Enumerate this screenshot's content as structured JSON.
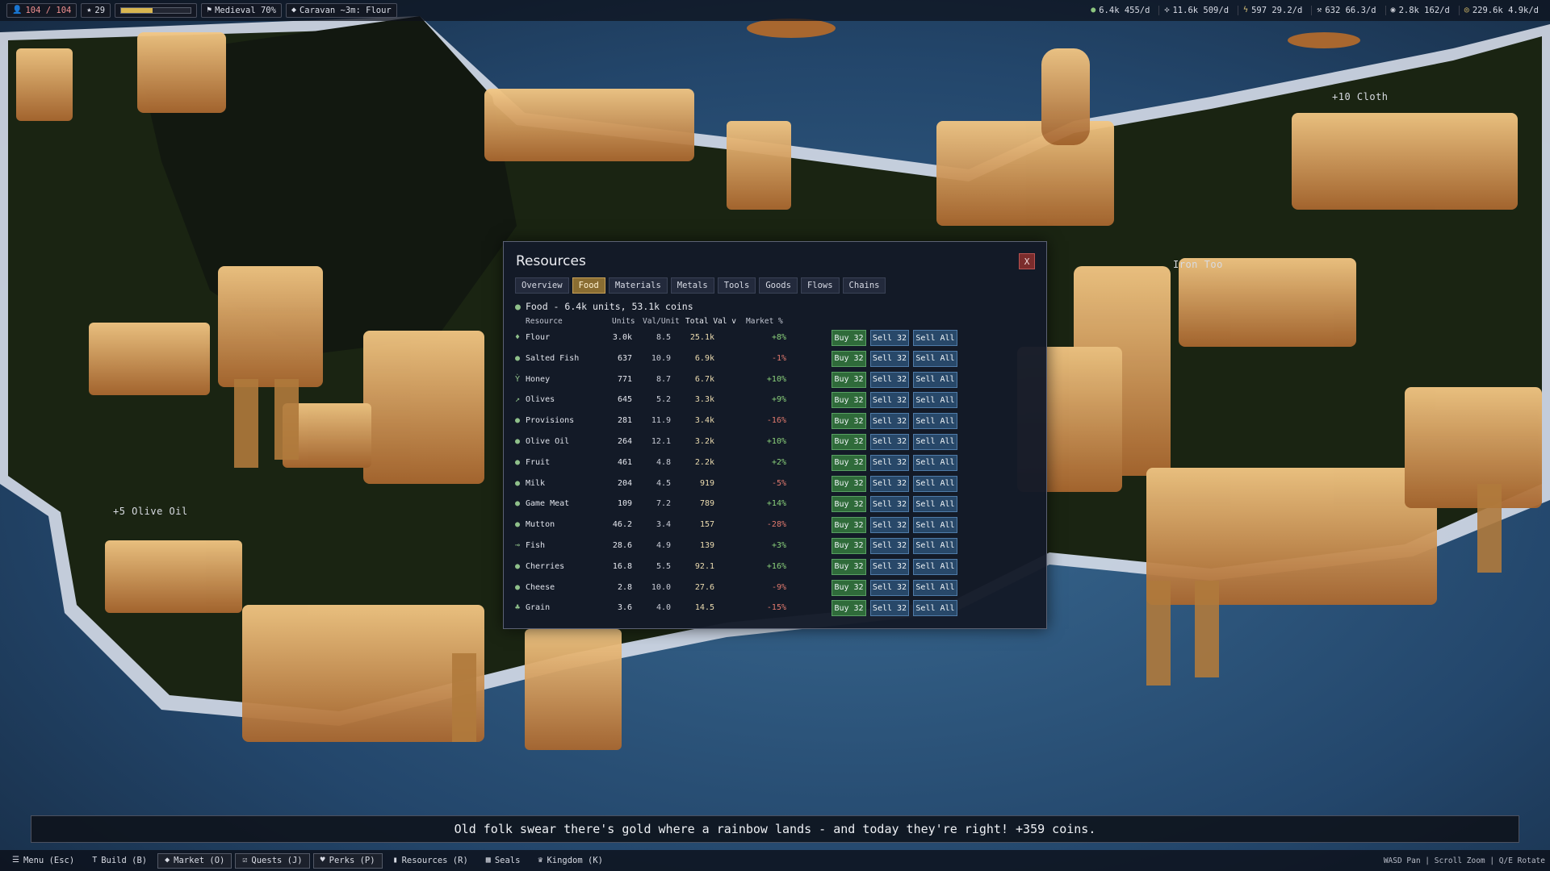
{
  "topbar": {
    "population": "104 / 104",
    "stars": "29",
    "progress_fraction": 0.45,
    "era": "Medieval 70%",
    "caravan": "Caravan ~3m: Flour",
    "resources": [
      {
        "icon": "food-icon",
        "glyph": "●",
        "text": "6.4k 455/d",
        "color": "#8cc47e"
      },
      {
        "icon": "materials-icon",
        "glyph": "✣",
        "text": "11.6k 509/d",
        "color": "#c8cbd4"
      },
      {
        "icon": "energy-icon",
        "glyph": "ϟ",
        "text": "597 29.2/d",
        "color": "#d8c27a"
      },
      {
        "icon": "tools-icon",
        "glyph": "⚒",
        "text": "632 66.3/d",
        "color": "#c8cbd4"
      },
      {
        "icon": "goods-icon",
        "glyph": "◉",
        "text": "2.8k 162/d",
        "color": "#c8cbd4"
      },
      {
        "icon": "coins-icon",
        "glyph": "◎",
        "text": "229.6k 4.9k/d",
        "color": "#e2c46e"
      }
    ]
  },
  "world_labels": [
    {
      "text": "+10 Cloth",
      "color": "#8fa3b8"
    },
    {
      "text": "Iron Too",
      "color": "#9aa3b0"
    },
    {
      "text": "+5 Olive Oil",
      "color": "#8fc7a0"
    }
  ],
  "modal": {
    "title": "Resources",
    "close_label": "X",
    "tabs": [
      "Overview",
      "Food",
      "Materials",
      "Metals",
      "Tools",
      "Goods",
      "Flows",
      "Chains"
    ],
    "active_tab": "Food",
    "section_title": "Food - 6.4k units, 53.1k coins",
    "columns": {
      "resource": "Resource",
      "units": "Units",
      "val_unit": "Val/Unit",
      "total_val": "Total Val v",
      "market": "Market %"
    },
    "buy_label": "Buy 32",
    "sell_label": "Sell 32",
    "sell_all_label": "Sell All",
    "rows": [
      {
        "icon": "flour-icon",
        "glyph": "♦",
        "name": "Flour",
        "units": "3.0k",
        "val": "8.5",
        "total": "25.1k",
        "market": "+8%"
      },
      {
        "icon": "salted-fish-icon",
        "glyph": "●",
        "name": "Salted Fish",
        "units": "637",
        "val": "10.9",
        "total": "6.9k",
        "market": "-1%"
      },
      {
        "icon": "honey-icon",
        "glyph": "Ỳ",
        "name": "Honey",
        "units": "771",
        "val": "8.7",
        "total": "6.7k",
        "market": "+10%"
      },
      {
        "icon": "olives-icon",
        "glyph": "↗",
        "name": "Olives",
        "units": "645",
        "val": "5.2",
        "total": "3.3k",
        "market": "+9%"
      },
      {
        "icon": "provisions-icon",
        "glyph": "●",
        "name": "Provisions",
        "units": "281",
        "val": "11.9",
        "total": "3.4k",
        "market": "-16%"
      },
      {
        "icon": "olive-oil-icon",
        "glyph": "●",
        "name": "Olive Oil",
        "units": "264",
        "val": "12.1",
        "total": "3.2k",
        "market": "+10%"
      },
      {
        "icon": "fruit-icon",
        "glyph": "●",
        "name": "Fruit",
        "units": "461",
        "val": "4.8",
        "total": "2.2k",
        "market": "+2%"
      },
      {
        "icon": "milk-icon",
        "glyph": "●",
        "name": "Milk",
        "units": "204",
        "val": "4.5",
        "total": "919",
        "market": "-5%"
      },
      {
        "icon": "game-meat-icon",
        "glyph": "●",
        "name": "Game Meat",
        "units": "109",
        "val": "7.2",
        "total": "789",
        "market": "+14%"
      },
      {
        "icon": "mutton-icon",
        "glyph": "●",
        "name": "Mutton",
        "units": "46.2",
        "val": "3.4",
        "total": "157",
        "market": "-28%"
      },
      {
        "icon": "fish-icon",
        "glyph": "⊸",
        "name": "Fish",
        "units": "28.6",
        "val": "4.9",
        "total": "139",
        "market": "+3%"
      },
      {
        "icon": "cherries-icon",
        "glyph": "●",
        "name": "Cherries",
        "units": "16.8",
        "val": "5.5",
        "total": "92.1",
        "market": "+16%"
      },
      {
        "icon": "cheese-icon",
        "glyph": "●",
        "name": "Cheese",
        "units": "2.8",
        "val": "10.0",
        "total": "27.6",
        "market": "-9%"
      },
      {
        "icon": "grain-icon",
        "glyph": "♣",
        "name": "Grain",
        "units": "3.6",
        "val": "4.0",
        "total": "14.5",
        "market": "-15%"
      }
    ]
  },
  "notification": "Old folk swear there's gold where a rainbow lands - and today they're right! +359 coins.",
  "bottombar": {
    "buttons": [
      {
        "icon": "menu-icon",
        "glyph": "☰",
        "label": "Menu (Esc)",
        "boxed": false
      },
      {
        "icon": "hammer-icon",
        "glyph": "T",
        "label": "Build (B)",
        "boxed": false
      },
      {
        "icon": "tag-icon",
        "glyph": "◆",
        "label": "Market (O)",
        "boxed": true
      },
      {
        "icon": "quest-icon",
        "glyph": "☑",
        "label": "Quests (J)",
        "boxed": true
      },
      {
        "icon": "heart-icon",
        "glyph": "♥",
        "label": "Perks (P)",
        "boxed": true
      },
      {
        "icon": "chart-icon",
        "glyph": "▮",
        "label": "Resources (R)",
        "boxed": false
      },
      {
        "icon": "seal-icon",
        "glyph": "▦",
        "label": "Seals",
        "boxed": false
      },
      {
        "icon": "crown-icon",
        "glyph": "♛",
        "label": "Kingdom (K)",
        "boxed": false
      }
    ],
    "hint": "WASD Pan | Scroll Zoom | Q/E Rotate"
  },
  "colors": {
    "accent_tab": "#8a6d32",
    "buy": "#2f6b3a",
    "sell": "#284869",
    "close": "#7b2c2c",
    "market_up": "#8bd17b",
    "market_down": "#e27a6e"
  }
}
